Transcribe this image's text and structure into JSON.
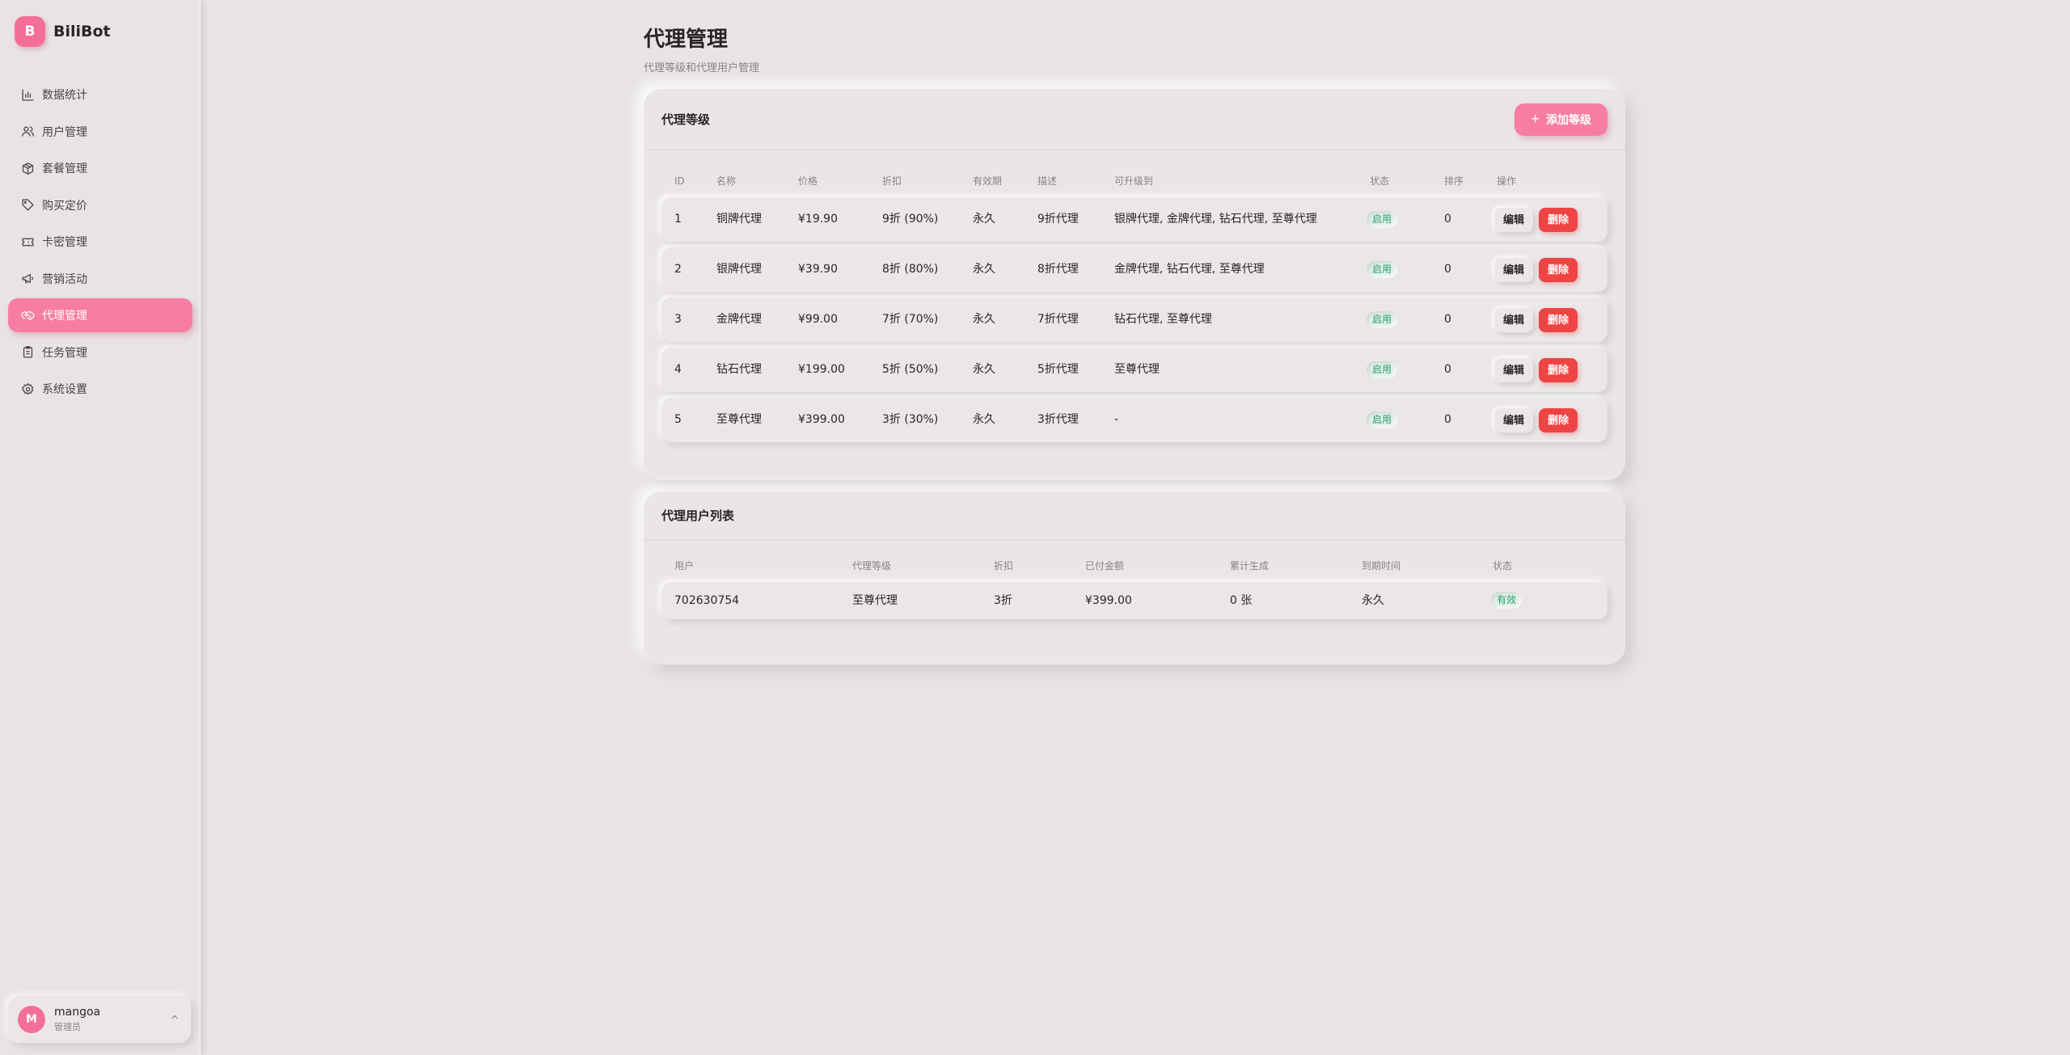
{
  "sidebar": {
    "brand_logo": "B",
    "brand_name": "BiliBot",
    "items": [
      {
        "label": "数据统计",
        "icon": "bar-chart-icon"
      },
      {
        "label": "用户管理",
        "icon": "users-icon"
      },
      {
        "label": "套餐管理",
        "icon": "package-icon"
      },
      {
        "label": "购买定价",
        "icon": "tag-icon"
      },
      {
        "label": "卡密管理",
        "icon": "ticket-icon"
      },
      {
        "label": "营销活动",
        "icon": "megaphone-icon"
      },
      {
        "label": "代理管理",
        "icon": "handshake-icon",
        "active": true
      },
      {
        "label": "任务管理",
        "icon": "clipboard-icon"
      },
      {
        "label": "系统设置",
        "icon": "gear-icon"
      }
    ],
    "user": {
      "avatar": "M",
      "name": "mangoa",
      "role": "管理员"
    }
  },
  "header": {
    "title": "代理管理",
    "subtitle": "代理等级和代理用户管理"
  },
  "levels": {
    "title": "代理等级",
    "add_label": "添加等级",
    "columns": [
      "ID",
      "名称",
      "价格",
      "折扣",
      "有效期",
      "描述",
      "可升级到",
      "状态",
      "排序",
      "操作"
    ],
    "edit_label": "编辑",
    "delete_label": "删除",
    "rows": [
      [
        "1",
        "铜牌代理",
        "¥19.90",
        "9折 (90%)",
        "永久",
        "9折代理",
        "银牌代理, 金牌代理, 钻石代理, 至尊代理",
        "启用",
        "0"
      ],
      [
        "2",
        "银牌代理",
        "¥39.90",
        "8折 (80%)",
        "永久",
        "8折代理",
        "金牌代理, 钻石代理, 至尊代理",
        "启用",
        "0"
      ],
      [
        "3",
        "金牌代理",
        "¥99.00",
        "7折 (70%)",
        "永久",
        "7折代理",
        "钻石代理, 至尊代理",
        "启用",
        "0"
      ],
      [
        "4",
        "钻石代理",
        "¥199.00",
        "5折 (50%)",
        "永久",
        "5折代理",
        "至尊代理",
        "启用",
        "0"
      ],
      [
        "5",
        "至尊代理",
        "¥399.00",
        "3折 (30%)",
        "永久",
        "3折代理",
        "-",
        "启用",
        "0"
      ]
    ]
  },
  "agents": {
    "title": "代理用户列表",
    "columns": [
      "用户",
      "代理等级",
      "折扣",
      "已付金额",
      "累计生成",
      "到期时间",
      "状态"
    ],
    "rows": [
      [
        "702630754",
        "至尊代理",
        "3折",
        "¥399.00",
        "0 张",
        "永久",
        "有效"
      ]
    ]
  },
  "colors": {
    "accent": "#f77ea2",
    "danger": "#ef4444",
    "success": "#22a36b",
    "background": "#e8e4e5"
  }
}
